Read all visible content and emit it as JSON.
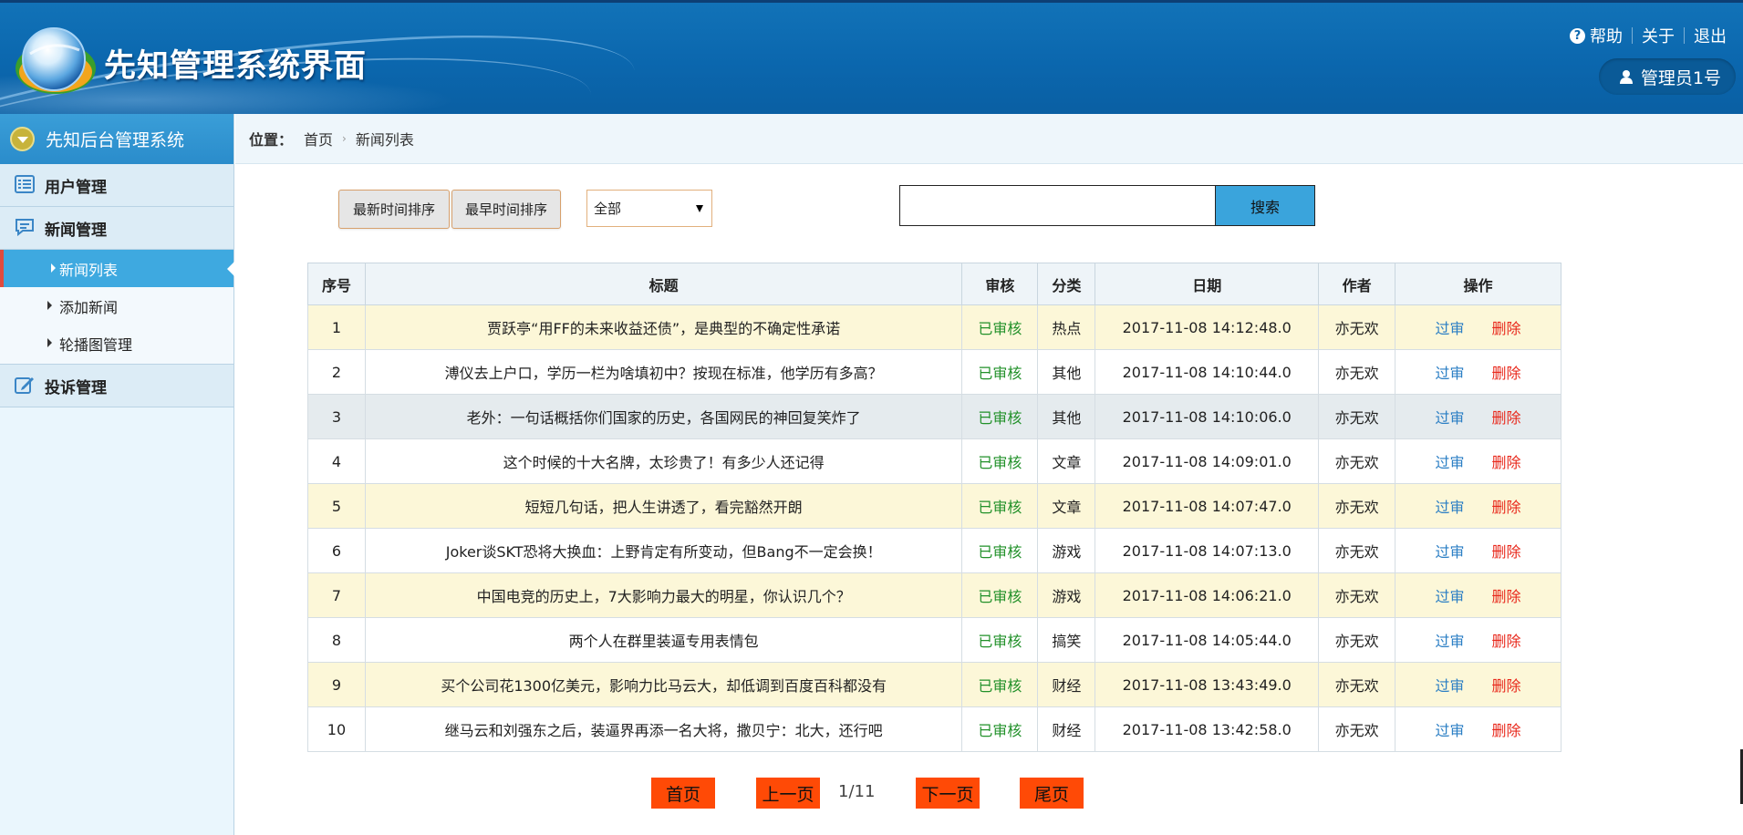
{
  "header": {
    "title": "先知管理系统界面",
    "links": {
      "help": "帮助",
      "about": "关于",
      "logout": "退出"
    },
    "user": "管理员1号"
  },
  "sidebar": {
    "title": "先知后台管理系统",
    "groups": [
      {
        "label": "用户管理",
        "icon": "list-icon"
      },
      {
        "label": "新闻管理",
        "icon": "chat-icon",
        "items": [
          {
            "label": "新闻列表",
            "active": true
          },
          {
            "label": "添加新闻",
            "active": false
          },
          {
            "label": "轮播图管理",
            "active": false
          }
        ]
      },
      {
        "label": "投诉管理",
        "icon": "edit-icon"
      }
    ]
  },
  "breadcrumb": {
    "label": "位置：",
    "home": "首页",
    "current": "新闻列表"
  },
  "toolbar": {
    "sort_newest": "最新时间排序",
    "sort_oldest": "最早时间排序",
    "filter_value": "全部",
    "search_value": "",
    "search_button": "搜索"
  },
  "table": {
    "headers": {
      "index": "序号",
      "title": "标题",
      "status": "审核",
      "category": "分类",
      "date": "日期",
      "author": "作者",
      "ops": "操作"
    },
    "rows": [
      {
        "index": "1",
        "title": "贾跃亭“用FF的未来收益还债”，是典型的不确定性承诺",
        "status": "已审核",
        "category": "热点",
        "date": "2017-11-08 14:12:48.0",
        "author": "亦无欢",
        "pass": "过审",
        "del": "删除"
      },
      {
        "index": "2",
        "title": "溥仪去上户口，学历一栏为啥填初中？按现在标准，他学历有多高？",
        "status": "已审核",
        "category": "其他",
        "date": "2017-11-08 14:10:44.0",
        "author": "亦无欢",
        "pass": "过审",
        "del": "删除"
      },
      {
        "index": "3",
        "title": "老外：一句话概括你们国家的历史，各国网民的神回复笑炸了",
        "status": "已审核",
        "category": "其他",
        "date": "2017-11-08 14:10:06.0",
        "author": "亦无欢",
        "pass": "过审",
        "del": "删除"
      },
      {
        "index": "4",
        "title": "这个时候的十大名牌，太珍贵了！有多少人还记得",
        "status": "已审核",
        "category": "文章",
        "date": "2017-11-08 14:09:01.0",
        "author": "亦无欢",
        "pass": "过审",
        "del": "删除"
      },
      {
        "index": "5",
        "title": "短短几句话，把人生讲透了，看完豁然开朗",
        "status": "已审核",
        "category": "文章",
        "date": "2017-11-08 14:07:47.0",
        "author": "亦无欢",
        "pass": "过审",
        "del": "删除"
      },
      {
        "index": "6",
        "title": "Joker谈SKT恐将大换血：上野肯定有所变动，但Bang不一定会换！",
        "status": "已审核",
        "category": "游戏",
        "date": "2017-11-08 14:07:13.0",
        "author": "亦无欢",
        "pass": "过审",
        "del": "删除"
      },
      {
        "index": "7",
        "title": "中国电竞的历史上，7大影响力最大的明星，你认识几个？",
        "status": "已审核",
        "category": "游戏",
        "date": "2017-11-08 14:06:21.0",
        "author": "亦无欢",
        "pass": "过审",
        "del": "删除"
      },
      {
        "index": "8",
        "title": "两个人在群里装逼专用表情包",
        "status": "已审核",
        "category": "搞笑",
        "date": "2017-11-08 14:05:44.0",
        "author": "亦无欢",
        "pass": "过审",
        "del": "删除"
      },
      {
        "index": "9",
        "title": "买个公司花1300亿美元，影响力比马云大，却低调到百度百科都没有",
        "status": "已审核",
        "category": "财经",
        "date": "2017-11-08 13:43:49.0",
        "author": "亦无欢",
        "pass": "过审",
        "del": "删除"
      },
      {
        "index": "10",
        "title": "继马云和刘强东之后，装逼界再添一名大将，撒贝宁：北大，还行吧",
        "status": "已审核",
        "category": "财经",
        "date": "2017-11-08 13:42:58.0",
        "author": "亦无欢",
        "pass": "过审",
        "del": "删除"
      }
    ]
  },
  "pager": {
    "first": "首页",
    "prev": "上一页",
    "info": "1/11",
    "next": "下一页",
    "last": "尾页"
  },
  "colors": {
    "header_blue": "#0b67ae",
    "sidebar_active": "#3ea9e0",
    "status_green": "#22912a",
    "pass_blue": "#2a7ec4",
    "delete_red": "#e8281b",
    "pager_orange": "#ff4a06",
    "row_yellow": "#fcf7d8"
  }
}
